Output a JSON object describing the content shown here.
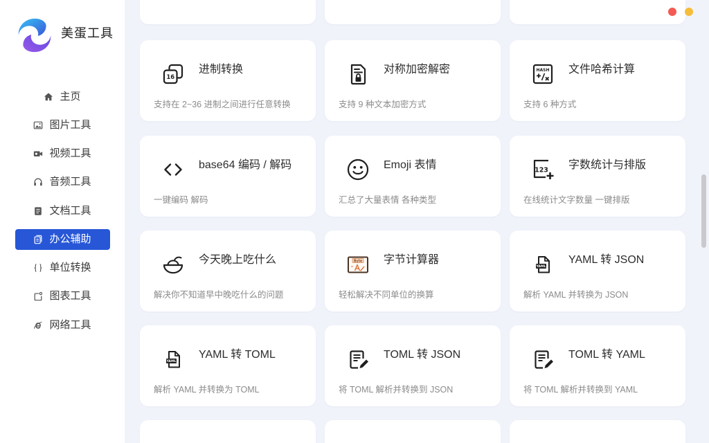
{
  "app": {
    "name": "美蛋工具"
  },
  "window_controls": [
    {
      "role": "close",
      "color": "#f35b54"
    },
    {
      "role": "minimize",
      "color": "#f6bd3b"
    }
  ],
  "theme": {
    "accent": "#2757d7",
    "main_bg": "#f1f3fb",
    "sidebar_bg": "#ffffff",
    "card_bg": "#ffffff",
    "text": "#2d2d2d",
    "muted_text": "#8b8b8b"
  },
  "sidebar": {
    "items": [
      {
        "label": "主页",
        "icon": "home-icon"
      },
      {
        "label": "图片工具",
        "icon": "image-icon"
      },
      {
        "label": "视频工具",
        "icon": "video-camera-icon"
      },
      {
        "label": "音频工具",
        "icon": "headphones-icon"
      },
      {
        "label": "文档工具",
        "icon": "document-icon"
      },
      {
        "label": "办公辅助",
        "icon": "copy-icon",
        "active": true
      },
      {
        "label": "单位转换",
        "icon": "braces-icon"
      },
      {
        "label": "图表工具",
        "icon": "chart-icon"
      },
      {
        "label": "网络工具",
        "icon": "browser-e-icon"
      }
    ]
  },
  "tools": [
    {
      "title": "进制转换",
      "description": "支持在 2~36 进制之间进行任意转换",
      "icon": "number-base-icon",
      "icon_text": "16"
    },
    {
      "title": "对称加密解密",
      "description": "支持 9 种文本加密方式",
      "icon": "lock-document-icon"
    },
    {
      "title": "文件哈希计算",
      "description": "支持 6 种方式",
      "icon": "hash-icon",
      "icon_text": "HASH"
    },
    {
      "title": "base64 编码 / 解码",
      "description": "一键编码 解码",
      "icon": "code-brackets-icon"
    },
    {
      "title": "Emoji 表情",
      "description": "汇总了大量表情 各种类型",
      "icon": "smiley-icon"
    },
    {
      "title": "字数统计与排版",
      "description": "在线统计文字数量 一键排版",
      "icon": "word-count-icon",
      "icon_text": "123"
    },
    {
      "title": "今天晚上吃什么",
      "description": "解决你不知道早中晚吃什么的问题",
      "icon": "bowl-icon"
    },
    {
      "title": "字节计算器",
      "description": "轻松解决不同单位的换算",
      "icon": "byte-calculator-icon",
      "icon_text": "Byte"
    },
    {
      "title": "YAML 转 JSON",
      "description": "解析 YAML 并转换为 JSON",
      "icon": "yaml-file-icon",
      "icon_text": "YAML"
    },
    {
      "title": "YAML 转 TOML",
      "description": "解析 YAML 并转换为 TOML",
      "icon": "yaml-file-icon",
      "icon_text": "YAML"
    },
    {
      "title": "TOML 转 JSON",
      "description": "将 TOML 解析并转换到 JSON",
      "icon": "edit-document-icon"
    },
    {
      "title": "TOML 转 YAML",
      "description": "将 TOML 解析并转换到 YAML",
      "icon": "edit-document-icon"
    }
  ]
}
